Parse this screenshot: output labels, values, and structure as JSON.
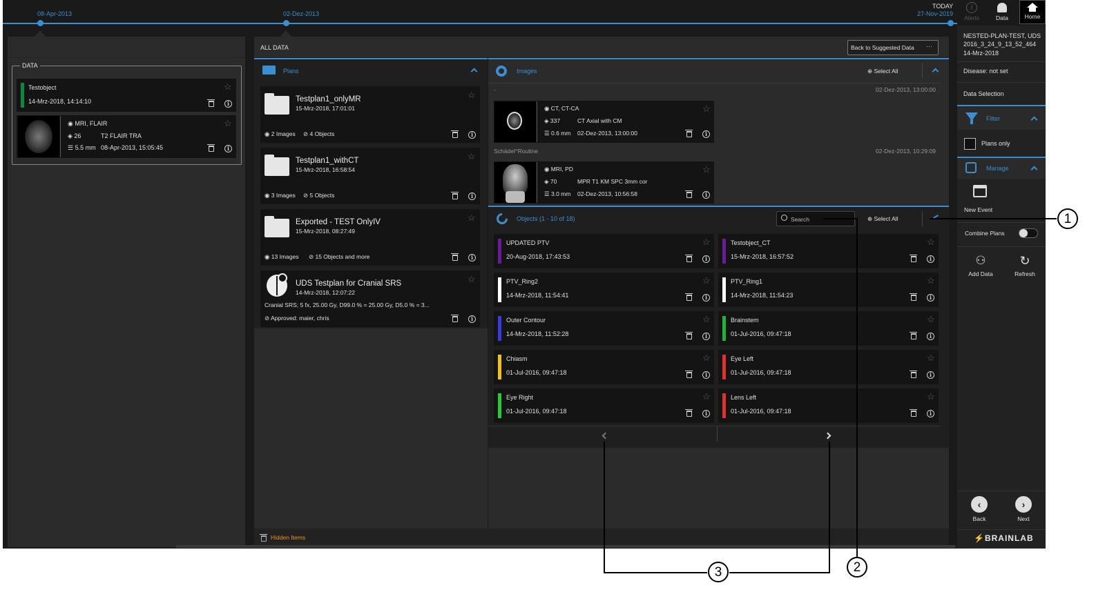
{
  "timeline": {
    "date1": "08-Apr-2013",
    "date2": "02-Dez-2013",
    "today_label": "TODAY",
    "today_date": "27-Nov-2019"
  },
  "left": {
    "title": "DATA",
    "item1": {
      "name": "Testobject",
      "date": "14-Mrz-2018, 14:14:10",
      "color": "#0a8a3c"
    },
    "item2": {
      "modality": "MRI, FLAIR",
      "count": "26",
      "series": "T2 FLAIR TRA",
      "thickness": "5.5 mm",
      "date": "08-Apr-2013, 15:05:45"
    }
  },
  "mid": {
    "header": "ALL DATA",
    "back_button": "Back to Suggested Data",
    "plans_title": "Plans",
    "plans": [
      {
        "name": "Testplan1_onlyMR",
        "date": "15-Mrz-2018, 17:01:01",
        "images": "2 Images",
        "objects": "4 Objects"
      },
      {
        "name": "Testplan1_withCT",
        "date": "15-Mrz-2018, 16:58:54",
        "images": "3 Images",
        "objects": "5 Objects"
      },
      {
        "name": "Exported - TEST OnlyIV",
        "date": "15-Mrz-2018, 08:27:49",
        "images": "13 Images",
        "objects": "15 Objects and more"
      },
      {
        "name": "UDS Testplan for Cranial SRS",
        "date": "14-Mrz-2018, 12:07:22",
        "desc": "Cranial SRS; 5 fx, 25.00 Gy, D99.0 % = 25.00 Gy, D5.0 % = 3...",
        "approved": "Approved:  maier, chris"
      }
    ],
    "hidden": "Hidden Items"
  },
  "images": {
    "title": "Images",
    "select_all": "Select All",
    "group1": {
      "name": "-",
      "date": "02-Dez-2013, 13:00:00"
    },
    "img1": {
      "modality": "CT, CT-CA",
      "count": "337",
      "series": "CT Axial with CM",
      "thickness": "0.6 mm",
      "date": "02-Dez-2013, 13:00:00"
    },
    "group2": {
      "name": "Schädel^Routine",
      "date": "02-Dez-2013, 10:29:09"
    },
    "img2": {
      "modality": "MRI, PD",
      "count": "70",
      "series": "MPR T1 KM SPC 3mm cor",
      "thickness": "3.0 mm",
      "date": "02-Dez-2013, 10:56:58"
    }
  },
  "objects": {
    "title": "Objects (1 - 10 of 18)",
    "search_placeholder": "Search",
    "select_all": "Select All",
    "items": [
      {
        "name": "UPDATED PTV",
        "date": "20-Aug-2018, 17:43:53",
        "color": "#6a1b9a"
      },
      {
        "name": "Testobject_CT",
        "date": "15-Mrz-2018, 16:57:52",
        "color": "#6a1b9a"
      },
      {
        "name": "PTV_Ring2",
        "date": "14-Mrz-2018, 11:54:41",
        "color": "#ffffff"
      },
      {
        "name": "PTV_Ring1",
        "date": "14-Mrz-2018, 11:54:23",
        "color": "#ffffff"
      },
      {
        "name": "Outer Contour",
        "date": "14-Mrz-2018, 11:52:28",
        "color": "#3a3adf"
      },
      {
        "name": "Brainstem",
        "date": "01-Jul-2016, 09:47:18",
        "color": "#1fb33a"
      },
      {
        "name": "Chiasm",
        "date": "01-Jul-2016, 09:47:18",
        "color": "#f5c400"
      },
      {
        "name": "Eye Left",
        "date": "01-Jul-2016, 09:47:18",
        "color": "#e03030"
      },
      {
        "name": "Eye Right",
        "date": "01-Jul-2016, 09:47:18",
        "color": "#22cc33"
      },
      {
        "name": "Lens Left",
        "date": "01-Jul-2016, 09:47:18",
        "color": "#e03030"
      }
    ]
  },
  "right": {
    "alerts": "Alerts",
    "data": "Data",
    "home": "Home",
    "plan_info": "NESTED-PLAN-TEST, UDS 2016_3_24_9_13_52_464",
    "plan_date": "14-Mrz-2018",
    "disease_label": "Disease:",
    "disease_value": "not set",
    "data_selection": "Data Selection",
    "filter": "Filter",
    "plans_only": "Plans only",
    "manage": "Manage",
    "new_event": "New Event",
    "combine_plans": "Combine Plans",
    "add_data": "Add Data",
    "refresh": "Refresh",
    "back": "Back",
    "next": "Next",
    "brand": "BRAINLAB"
  },
  "callouts": {
    "c1": "1",
    "c2": "2",
    "c3": "3"
  }
}
